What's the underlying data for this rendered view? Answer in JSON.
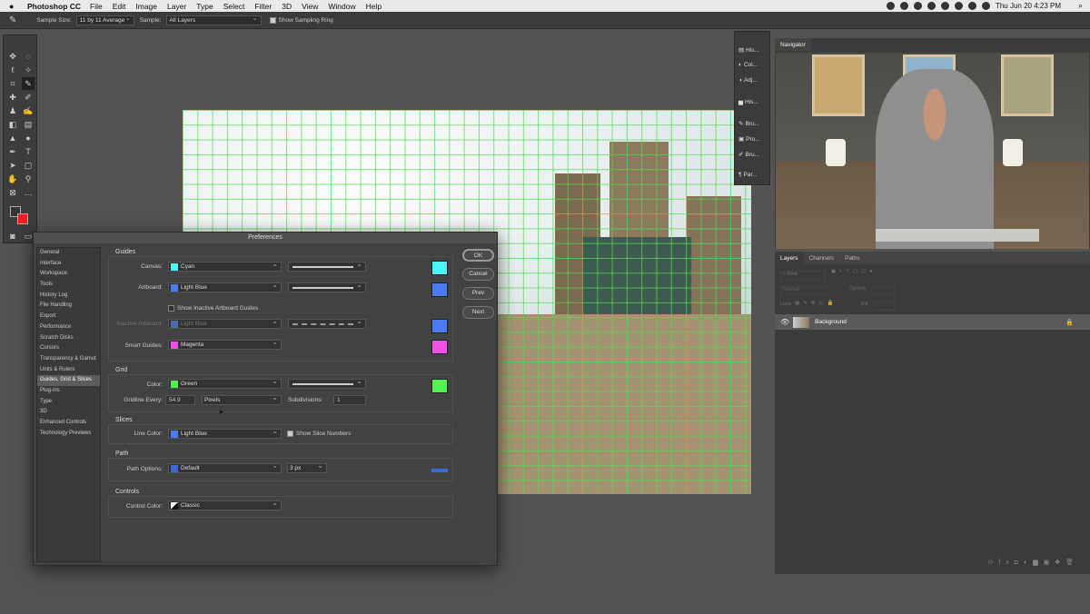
{
  "menubar": {
    "app": "Photoshop CC",
    "items": [
      "File",
      "Edit",
      "Image",
      "Layer",
      "Type",
      "Select",
      "Filter",
      "3D",
      "View",
      "Window",
      "Help"
    ],
    "clock": "Thu Jun 20 4:23 PM"
  },
  "options": {
    "sample_size_label": "Sample Size:",
    "sample_size_value": "11 by 11 Average",
    "sample_label": "Sample:",
    "sample_value": "All Layers",
    "show_ring": "Show Sampling Ring"
  },
  "panels": {
    "hist1": "His...",
    "col": "Col...",
    "adj": "Adj...",
    "hist2": "His...",
    "bru1": "Bru...",
    "pro": "Pro...",
    "bru2": "Bru...",
    "par": "Par..."
  },
  "navigator": {
    "tab": "Navigator"
  },
  "layers": {
    "tabs": [
      "Layers",
      "Channels",
      "Paths"
    ],
    "kind": "Kind",
    "mode": "Normal",
    "opacity_label": "Opacity:",
    "lock_label": "Lock:",
    "fill_label": "Fill:",
    "layer_name": "Background"
  },
  "prefs": {
    "title": "Preferences",
    "categories": [
      "General",
      "Interface",
      "Workspace",
      "Tools",
      "History Log",
      "File Handling",
      "Export",
      "Performance",
      "Scratch Disks",
      "Cursors",
      "Transparency & Gamut",
      "Units & Rulers",
      "Guides, Grid & Slices",
      "Plug-ins",
      "Type",
      "3D",
      "Enhanced Controls",
      "Technology Previews"
    ],
    "buttons": {
      "ok": "OK",
      "cancel": "Cancel",
      "prev": "Prev",
      "next": "Next"
    },
    "guides": {
      "title": "Guides",
      "canvas_label": "Canvas:",
      "canvas_value": "Cyan",
      "artboard_label": "Artboard:",
      "artboard_value": "Light Blue",
      "show_inactive": "Show Inactive Artboard Guides",
      "inactive_label": "Inactive Artboard:",
      "inactive_value": "Light Blue",
      "smart_label": "Smart Guides:",
      "smart_value": "Magenta"
    },
    "grid": {
      "title": "Grid",
      "color_label": "Color:",
      "color_value": "Green",
      "gridline_label": "Gridline Every:",
      "gridline_value": "54.9",
      "unit_value": "Pixels",
      "subdiv_label": "Subdivisions:",
      "subdiv_value": "1"
    },
    "slices": {
      "title": "Slices",
      "line_label": "Line Color:",
      "line_value": "Light Blue",
      "show_numbers": "Show Slice Numbers"
    },
    "path": {
      "title": "Path",
      "options_label": "Path Options:",
      "options_value": "Default",
      "width_value": "3 px"
    },
    "controls": {
      "title": "Controls",
      "color_label": "Control Color:",
      "color_value": "Classic"
    }
  },
  "colors": {
    "cyan": "#4ff3f6",
    "lightblue": "#4a7bf2",
    "magenta": "#f050e6",
    "green": "#52f252",
    "pathblue": "#3a6bd6"
  }
}
